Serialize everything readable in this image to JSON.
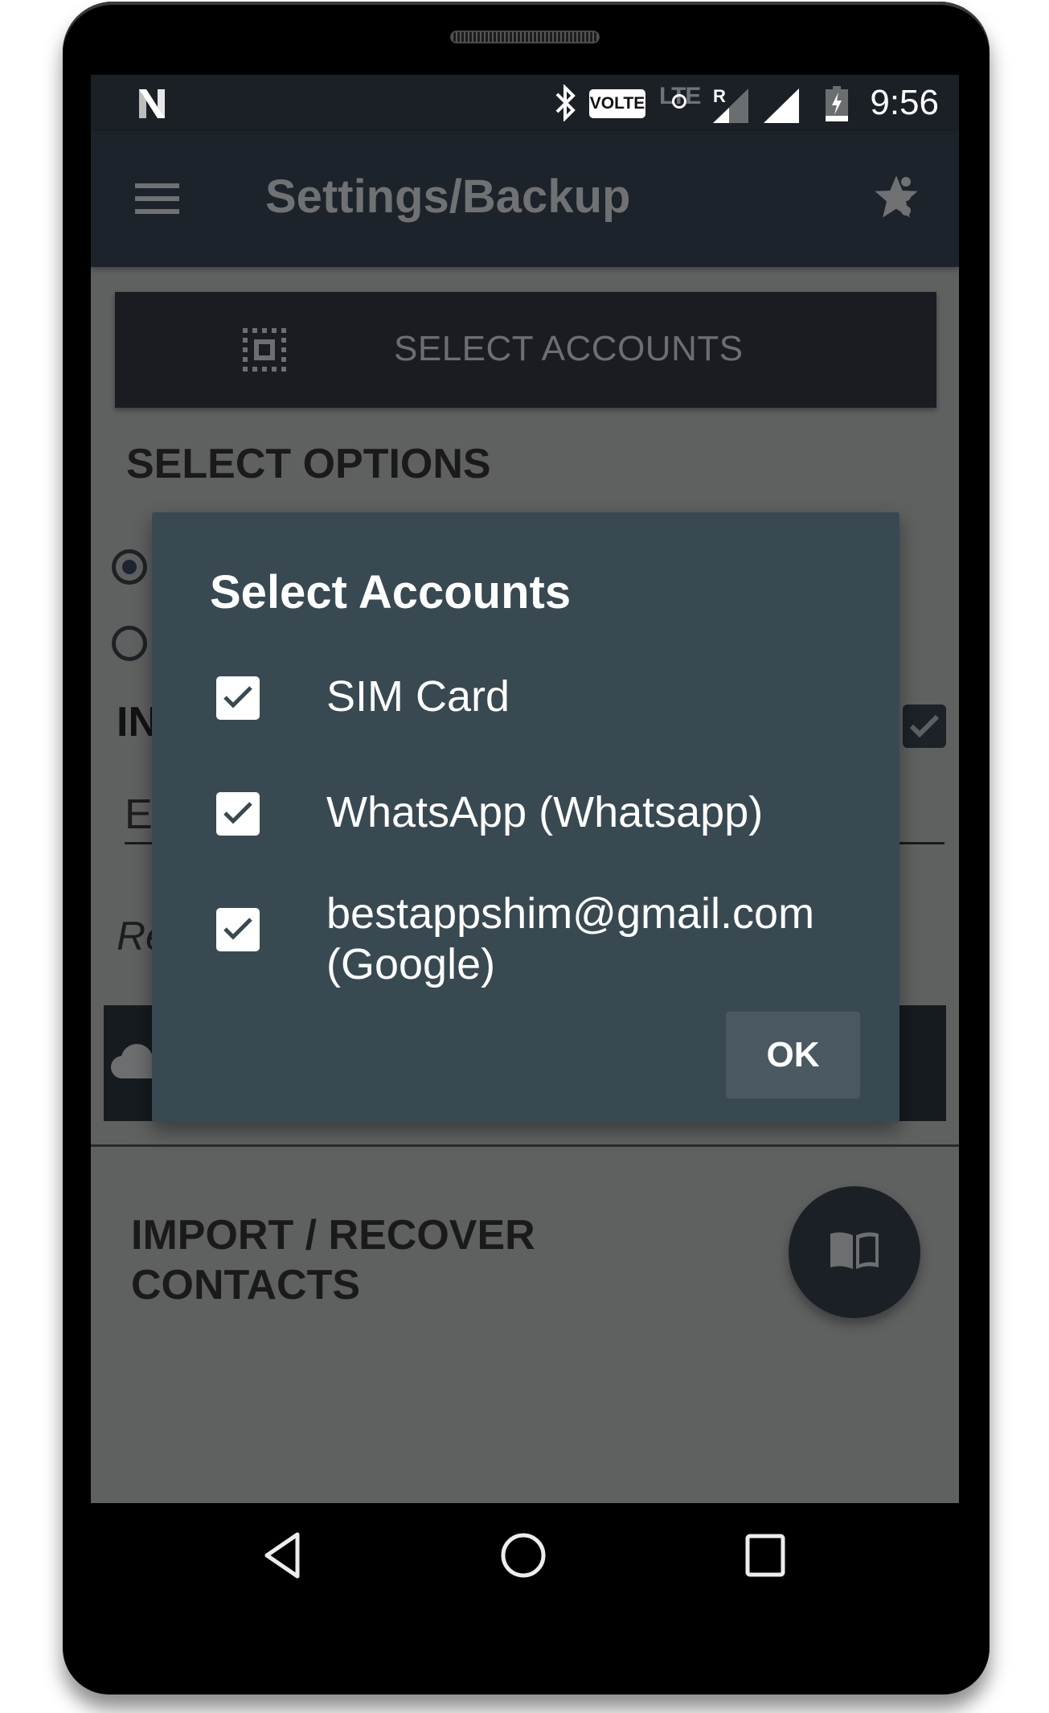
{
  "status_bar": {
    "time": "9:56",
    "volte_label": "VOLTE",
    "lte_label": "LTE",
    "roaming_label": "R",
    "icons": [
      "android-n-icon",
      "bluetooth-icon",
      "volte-badge",
      "lte-disabled-icon",
      "signal-roaming-icon",
      "signal-icon",
      "battery-charging-icon"
    ]
  },
  "toolbar": {
    "title": "Settings/Backup",
    "menu_icon": "hamburger-menu-icon",
    "star_icon": "star-icon",
    "overflow_icon": "more-vert-icon"
  },
  "background": {
    "select_accounts_button": "SELECT ACCOUNTS",
    "select_options_heading": "SELECT OPTIONS",
    "section_label_partial": "IN",
    "field_partial": "En",
    "italic_partial": "Re",
    "import_heading_line1": "IMPORT / RECOVER",
    "import_heading_line2": "CONTACTS"
  },
  "dialog": {
    "title": "Select Accounts",
    "options": [
      {
        "label": "SIM Card",
        "checked": true
      },
      {
        "label": "WhatsApp (Whatsapp)",
        "checked": true
      },
      {
        "label_line1": "bestappshim@gmail.com",
        "label_line2": "(Google)",
        "checked": true
      }
    ],
    "ok_label": "OK"
  },
  "colors": {
    "toolbar": "#1d232a",
    "dialog": "#394951",
    "ok_button": "#4a5961",
    "scrim_content": "#5f6160"
  },
  "nav_bar": {
    "buttons": [
      "back",
      "home",
      "recents"
    ]
  }
}
